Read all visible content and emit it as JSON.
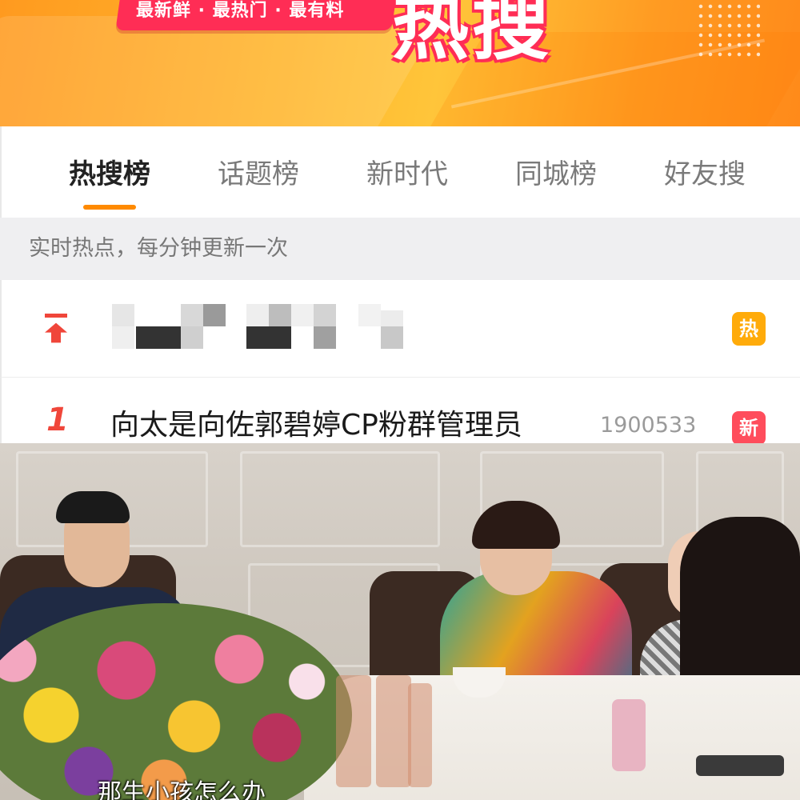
{
  "banner": {
    "slogan": "最新鲜 · 最热门 · 最有料",
    "logo_text": "热搜"
  },
  "tabs": [
    {
      "label": "热搜榜",
      "active": true
    },
    {
      "label": "话题榜",
      "active": false
    },
    {
      "label": "新时代",
      "active": false
    },
    {
      "label": "同城榜",
      "active": false
    },
    {
      "label": "好友搜",
      "active": false
    }
  ],
  "subtitle": "实时热点，每分钟更新一次",
  "list": {
    "pinned": {
      "icon": "pin-top-icon",
      "title": "",
      "title_pixelated": true,
      "badge": "热"
    },
    "items": [
      {
        "rank": "1",
        "title": "向太是向佐郭碧婷CP粉群管理员",
        "count": "1900533",
        "badge": "新"
      }
    ]
  },
  "video": {
    "caption": "那生小孩怎么办"
  },
  "colors": {
    "accent": "#ff8a00",
    "hot_badge": "#ffab0a",
    "new_badge": "#ff4d5c",
    "rank": "#f0463a"
  }
}
